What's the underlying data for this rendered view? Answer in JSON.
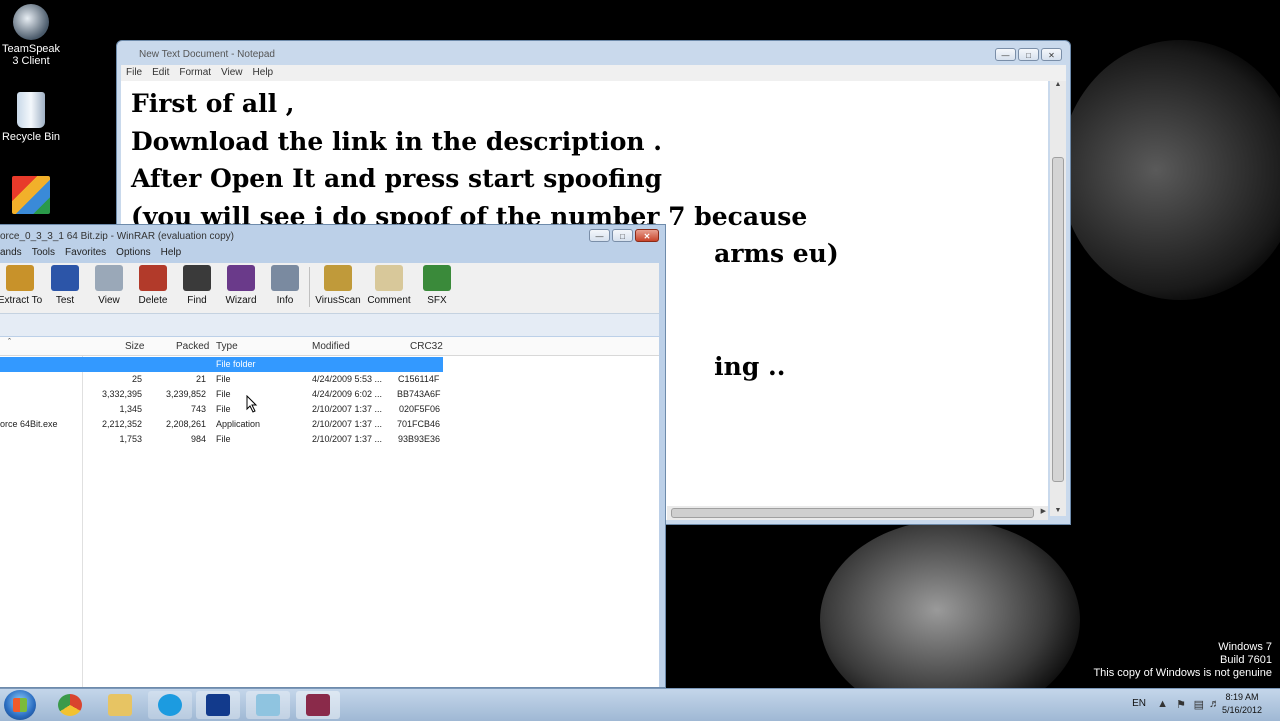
{
  "desktop": {
    "icons": [
      {
        "label": "TeamSpeak 3 Client",
        "icon": "teamspeak-icon"
      },
      {
        "label": "Recycle Bin",
        "icon": "recycle-bin-icon"
      },
      {
        "label": "",
        "icon": "avg-icon"
      }
    ],
    "watermark": {
      "line1": "Windows 7",
      "line2": "Build 7601",
      "line3": "This copy of Windows is not genuine"
    }
  },
  "notepad": {
    "title": "New Text Document - Notepad",
    "menu": [
      "File",
      "Edit",
      "Format",
      "View",
      "Help"
    ],
    "text": "First of all ,\nDownload the link in the description .\nAfter Open It and press start spoofing\n(you will see i do spoof of the number 7 because\n                                                                   arms eu)\n\n\n                                                                   ing .."
  },
  "winrar": {
    "title": "orce_0_3_3_1 64 Bit.zip - WinRAR (evaluation copy)",
    "menu": [
      "ands",
      "Tools",
      "Favorites",
      "Options",
      "Help"
    ],
    "toolbar": [
      {
        "label": "Extract To",
        "icon": "extract-to-icon",
        "color": "#c8922a"
      },
      {
        "label": "Test",
        "icon": "test-icon",
        "color": "#2c55a8"
      },
      {
        "label": "View",
        "icon": "view-icon",
        "color": "#9aa8b8"
      },
      {
        "label": "Delete",
        "icon": "delete-icon",
        "color": "#b23a2a"
      },
      {
        "label": "Find",
        "icon": "find-icon",
        "color": "#3a3a3a"
      },
      {
        "label": "Wizard",
        "icon": "wizard-icon",
        "color": "#6a3a8a"
      },
      {
        "label": "Info",
        "icon": "info-icon",
        "color": "#7a8aa0"
      },
      {
        "label": "VirusScan",
        "icon": "virusscan-icon",
        "color": "#c09a3a"
      },
      {
        "label": "Comment",
        "icon": "comment-icon",
        "color": "#d8c89a"
      },
      {
        "label": "SFX",
        "icon": "sfx-icon",
        "color": "#3a8a3a"
      }
    ],
    "columns": {
      "size": "Size",
      "packed": "Packed",
      "type": "Type",
      "modified": "Modified",
      "crc": "CRC32"
    },
    "files": [
      {
        "name": "",
        "size": "",
        "packed": "",
        "type": "File folder",
        "modified": "",
        "crc": "",
        "selected": true
      },
      {
        "name": "",
        "size": "25",
        "packed": "21",
        "type": "File",
        "modified": "4/24/2009 5:53 ...",
        "crc": "C156114F",
        "selected": false
      },
      {
        "name": "",
        "size": "3,332,395",
        "packed": "3,239,852",
        "type": "File",
        "modified": "4/24/2009 6:02 ...",
        "crc": "BB743A6F",
        "selected": false
      },
      {
        "name": "",
        "size": "1,345",
        "packed": "743",
        "type": "File",
        "modified": "2/10/2007 1:37 ...",
        "crc": "020F5F06",
        "selected": false
      },
      {
        "name": "orce 64Bit.exe",
        "size": "2,212,352",
        "packed": "2,208,261",
        "type": "Application",
        "modified": "2/10/2007 1:37 ...",
        "crc": "701FCB46",
        "selected": false
      },
      {
        "name": "",
        "size": "1,753",
        "packed": "984",
        "type": "File",
        "modified": "2/10/2007 1:37 ...",
        "crc": "93B93E36",
        "selected": false
      }
    ]
  },
  "taskbar": {
    "buttons": [
      {
        "icon": "chrome-icon",
        "color": "#d9442e"
      },
      {
        "icon": "folder-icon",
        "color": "#e7c463"
      },
      {
        "icon": "skype-icon",
        "color": "#1c9be0"
      },
      {
        "icon": "app-blue-icon",
        "color": "#123a8c"
      },
      {
        "icon": "notepad-icon",
        "color": "#8fc4e0"
      },
      {
        "icon": "winrar-icon",
        "color": "#8a2a4a"
      }
    ],
    "language": "EN",
    "time": "8:19 AM",
    "date": "5/16/2012"
  }
}
